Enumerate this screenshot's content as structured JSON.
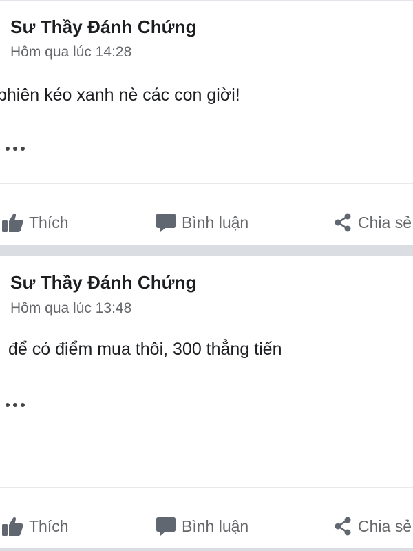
{
  "posts": [
    {
      "author": "Sư Thầy Đánh Chứng",
      "timestamp": "Hôm qua lúc 14:28",
      "text": "phiên kéo xanh nè các con giời!",
      "actions": {
        "like": "Thích",
        "comment": "Bình luận",
        "share": "Chia sẻ"
      }
    },
    {
      "author": "Sư Thầy Đánh Chứng",
      "timestamp": "Hôm qua lúc 13:48",
      "text": "để có điểm mua thôi, 300 thẳng tiến",
      "actions": {
        "like": "Thích",
        "comment": "Bình luận",
        "share": "Chia sẻ"
      }
    }
  ],
  "icons": {
    "like": "thumbs-up-icon",
    "comment": "speech-bubble-icon",
    "share": "share-icon",
    "more": "ellipsis-icon"
  },
  "colors": {
    "text_primary": "#1c1e21",
    "text_secondary": "#65676b",
    "divider": "#e4e6eb",
    "section_gap": "#dadde1"
  }
}
